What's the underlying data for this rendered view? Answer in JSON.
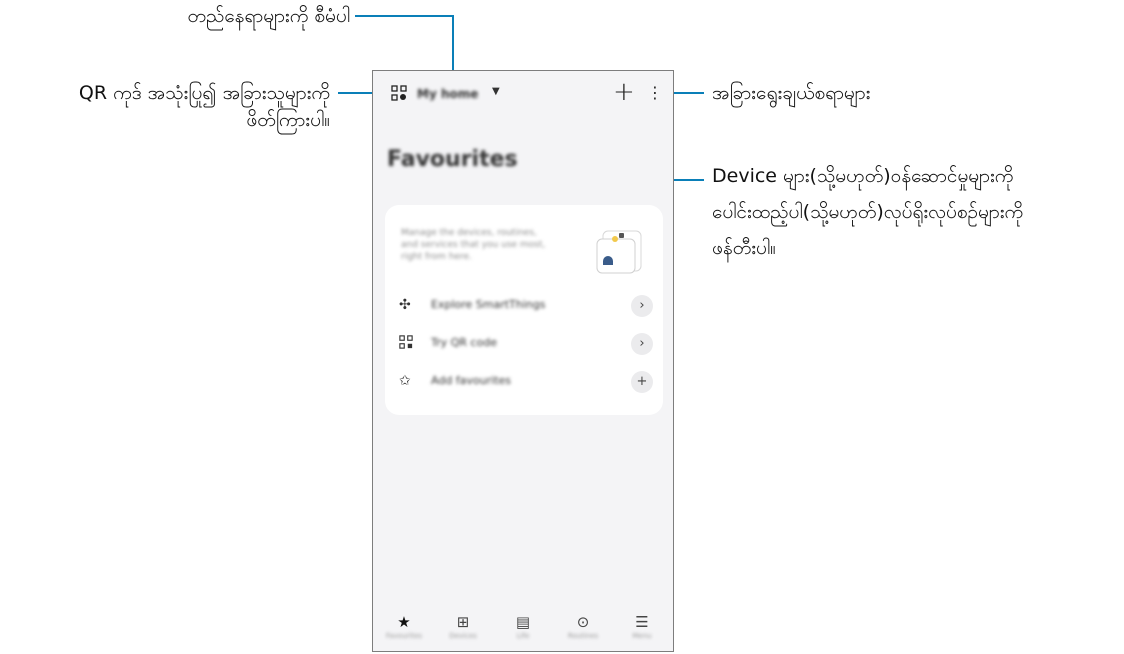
{
  "callouts": {
    "change_location": "တည်နေရာများကို စီမံပါ",
    "qr_line1": "QR ကုဒ် အသုံးပြု၍ အခြားသူများကို",
    "qr_line2": "ဖိတ်ကြားပါ။",
    "more_options": "အခြားရွေးချယ်စရာများ",
    "add_line1": "Device များ(သို့မဟုတ်)ဝန်ဆောင်မှုများကို",
    "add_line2": "ပေါင်းထည့်ပါ(သို့မဟုတ်)လုပ်ရိုးလုပ်စဥ်များကို",
    "add_line3": "ဖန်တီးပါ။"
  },
  "app": {
    "home_name": "My home",
    "favourites_title": "Favourites",
    "card_text": "Manage the devices, routines, and services that you use most, right from here.",
    "rows": [
      {
        "icon": "explore-icon",
        "label": "Explore SmartThings",
        "action": "›"
      },
      {
        "icon": "qr-code-icon",
        "label": "Try QR code",
        "action": "›"
      },
      {
        "icon": "star-add-icon",
        "label": "Add favourites",
        "action": "+"
      }
    ],
    "nav": [
      {
        "icon": "star-icon",
        "label": "Favourites"
      },
      {
        "icon": "devices-icon",
        "label": "Devices"
      },
      {
        "icon": "life-icon",
        "label": "Life"
      },
      {
        "icon": "routines-icon",
        "label": "Routines"
      },
      {
        "icon": "menu-icon",
        "label": "Menu"
      }
    ]
  },
  "colors": {
    "callout_line": "#0a7fb8",
    "phone_bg": "#f4f4f6"
  }
}
